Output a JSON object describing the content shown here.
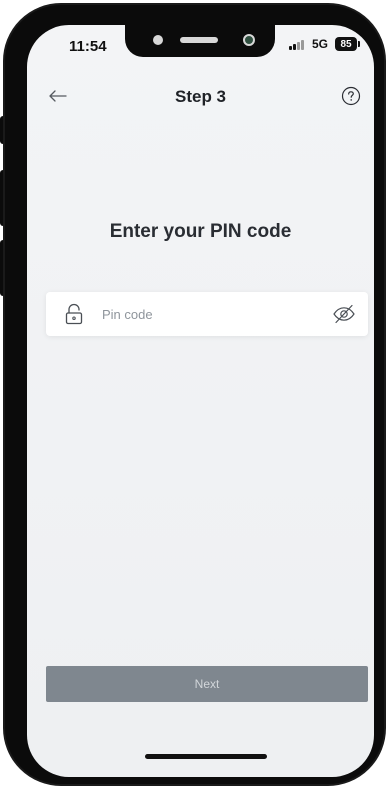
{
  "status_bar": {
    "time": "11:54",
    "network": "5G",
    "battery": "85"
  },
  "header": {
    "title": "Step 3",
    "back_icon": "arrow-left-icon",
    "help_icon": "question-circle-icon"
  },
  "main": {
    "heading": "Enter your PIN code",
    "pin_field": {
      "placeholder": "Pin code",
      "value": "",
      "leading_icon": "lock-icon",
      "trailing_icon": "eye-off-icon"
    },
    "next_button_label": "Next"
  },
  "colors": {
    "background": "#f1f2f4",
    "button_disabled": "#7f878f",
    "text_primary": "#1f2227"
  }
}
